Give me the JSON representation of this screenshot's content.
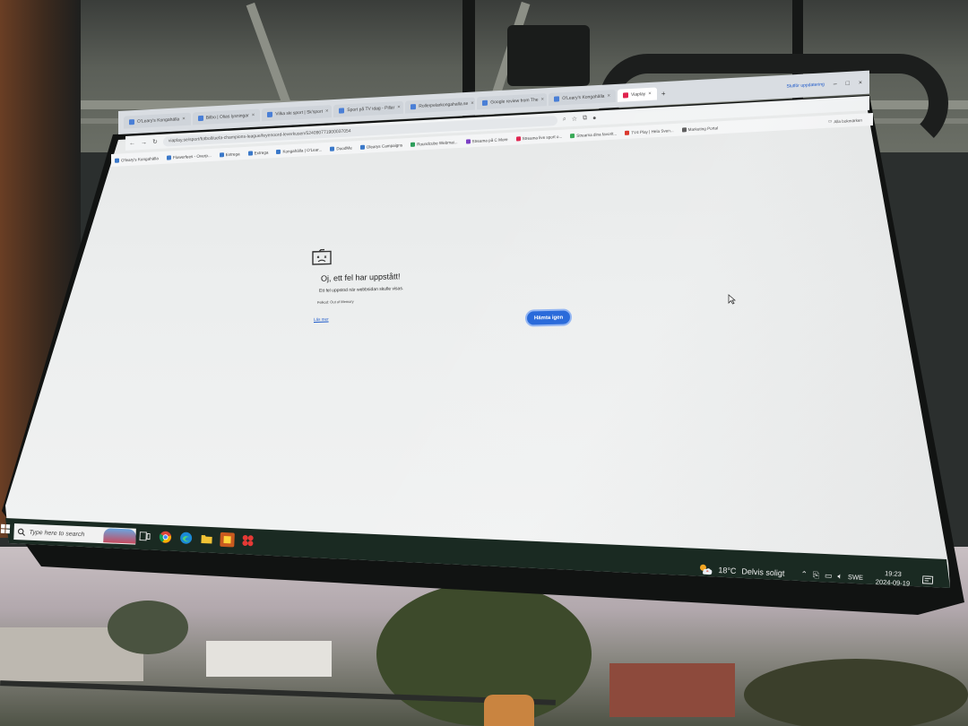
{
  "browser": {
    "tabs": [
      {
        "label": "O'Leary's Kongahälla",
        "active": false
      },
      {
        "label": "Bilbo | Olias lysningar",
        "active": false
      },
      {
        "label": "Vilka ski sport | Sk'sport",
        "active": false
      },
      {
        "label": "Sport på TV idag - Pillar",
        "active": false
      },
      {
        "label": "Rollerpelarkongahalla.se",
        "active": false
      },
      {
        "label": "Google review from The",
        "active": false
      },
      {
        "label": "O'Leary's Kongahälla",
        "active": false
      },
      {
        "label": "Viaplay",
        "active": true
      }
    ],
    "new_tab_label": "+",
    "update_label": "Slutför uppdatering",
    "address": "viaplay.se/sport/fotboll/uefa-champions-league/feyenoord-leverkusen/524090771900037054",
    "bookmarks": [
      "O'leary's Kongahälla",
      "Flowerfees - Overp...",
      "Extrega",
      "Extrega",
      "Kongahälla | O'Lear...",
      "DoodMe",
      "Olearys Campaigns",
      "Roundcube Webmai...",
      "Streama på C More",
      "Streama live sport o...",
      "Streama dina favorit...",
      "TV4 Play | Hela Sven...",
      "Marketing Portal"
    ],
    "all_bookmarks_label": "Alla bokmärken"
  },
  "error_page": {
    "title": "Oj, ett fel har uppstått!",
    "description": "Ett fel uppstod när webbsidan skulle visas.",
    "error_code": "Felkod: Out of Memory",
    "learn_more": "Läs mer",
    "reload_button": "Hämta igen"
  },
  "taskbar": {
    "search_placeholder": "Type here to search",
    "weather_temp": "18°C",
    "weather_desc": "Delvis soligt",
    "language": "SWE",
    "time": "19:23",
    "date": "2024-09-19"
  },
  "colors": {
    "primary_button": "#1f63d8",
    "link": "#1a57c9",
    "taskbar": "#1a2a22",
    "page_background": "#eceeee"
  }
}
